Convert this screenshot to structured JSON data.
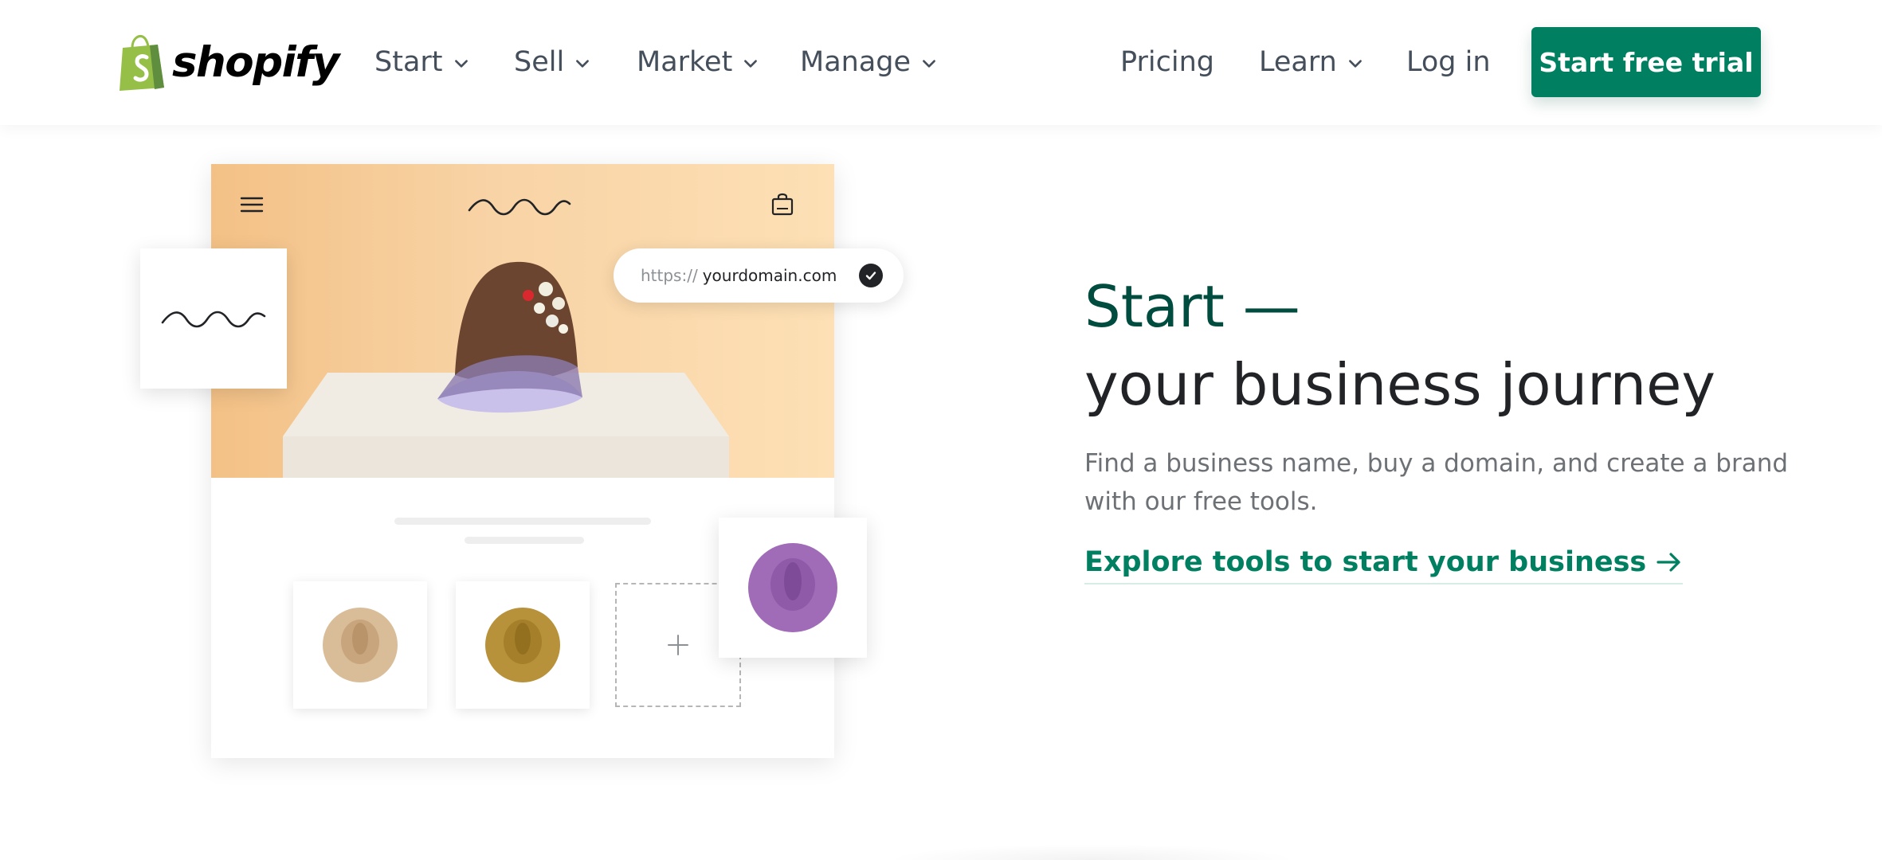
{
  "header": {
    "logo_text": "shopify",
    "nav_left": [
      {
        "label": "Start",
        "icon": "chevron-down-icon"
      },
      {
        "label": "Sell",
        "icon": "chevron-down-icon"
      },
      {
        "label": "Market",
        "icon": "chevron-down-icon"
      },
      {
        "label": "Manage",
        "icon": "chevron-down-icon"
      }
    ],
    "nav_right": {
      "pricing": "Pricing",
      "learn": "Learn",
      "login": "Log in"
    },
    "cta_label": "Start free trial"
  },
  "illustration": {
    "domain_protocol": "https://",
    "domain_name": "yourdomain.com",
    "thumb_colors": [
      "#d9bd98",
      "#b8923a"
    ],
    "featured_hat_color": "#a06cb8",
    "hero_gradient": [
      "#f3c186",
      "#fde0b5"
    ]
  },
  "hero_copy": {
    "headline_accent": "Start —",
    "headline_main": "your business journey",
    "subcopy": "Find a business name, buy a domain, and create a brand with our free tools.",
    "link_label": "Explore tools to start your business"
  },
  "colors": {
    "brand_green": "#008060",
    "dark_green": "#004c3f",
    "text": "#212326",
    "muted": "#6d7175"
  }
}
